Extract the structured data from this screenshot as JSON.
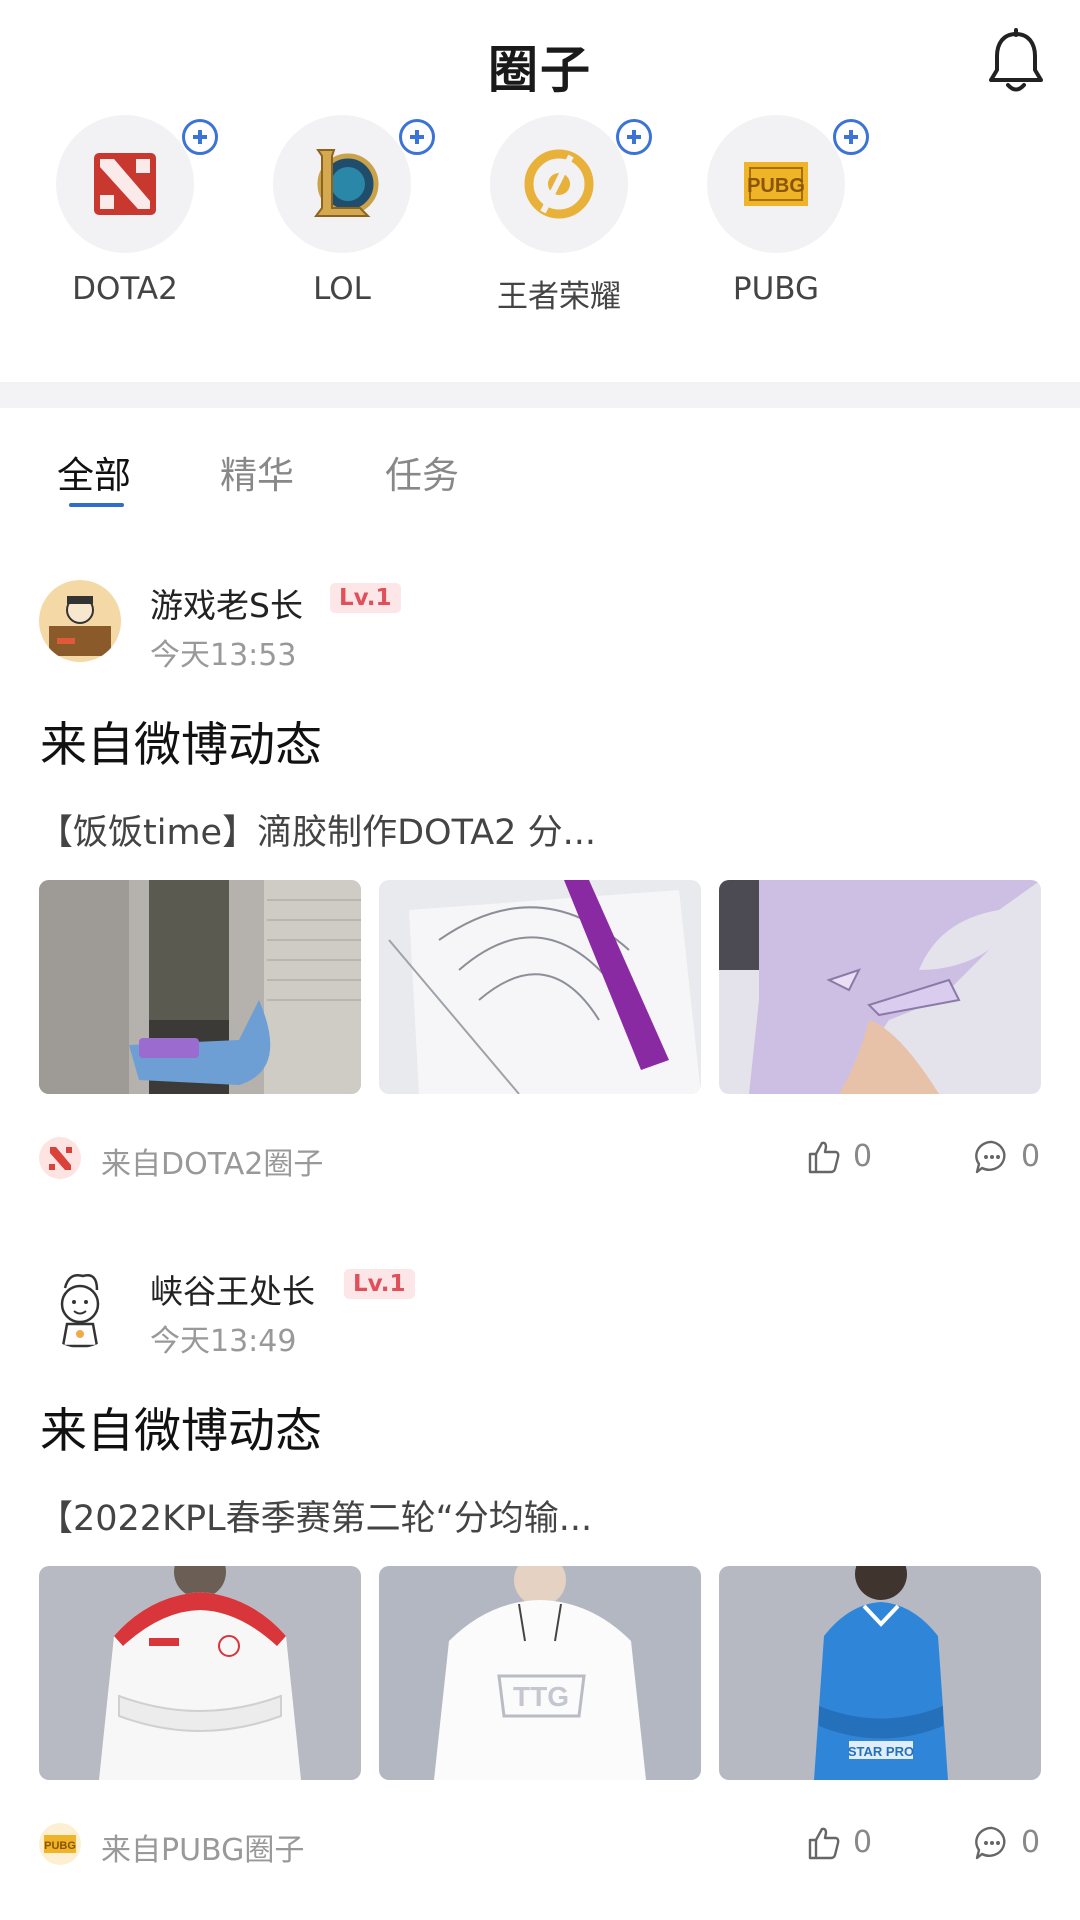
{
  "header": {
    "title": "圈子",
    "notification_icon": "bell-icon"
  },
  "circles": [
    {
      "name": "DOTA2",
      "icon": "dota2-logo"
    },
    {
      "name": "LOL",
      "icon": "lol-logo"
    },
    {
      "name": "王者荣耀",
      "icon": "honor-of-kings-logo"
    },
    {
      "name": "PUBG",
      "icon": "pubg-logo"
    }
  ],
  "tabs": [
    {
      "label": "全部",
      "active": true
    },
    {
      "label": "精华",
      "active": false
    },
    {
      "label": "任务",
      "active": false
    }
  ],
  "posts": [
    {
      "username": "游戏老S长",
      "level": "Lv.1",
      "time": "今天13:53",
      "title": "来自微博动态",
      "excerpt": "【饭饭time】滴胶制作DOTA2 分...",
      "source": "来自DOTA2圈子",
      "likes": "0",
      "comments": "0"
    },
    {
      "username": "峡谷王处长",
      "level": "Lv.1",
      "time": "今天13:49",
      "title": "来自微博动态",
      "excerpt": "【2022KPL春季赛第二轮“分均输...",
      "source": "来自PUBG圈子",
      "likes": "0",
      "comments": "0"
    }
  ],
  "colors": {
    "accent": "#2f6bd1",
    "level_badge": "#e0505a",
    "pubg_gold": "#f0b429",
    "dota_red": "#d9413a"
  }
}
